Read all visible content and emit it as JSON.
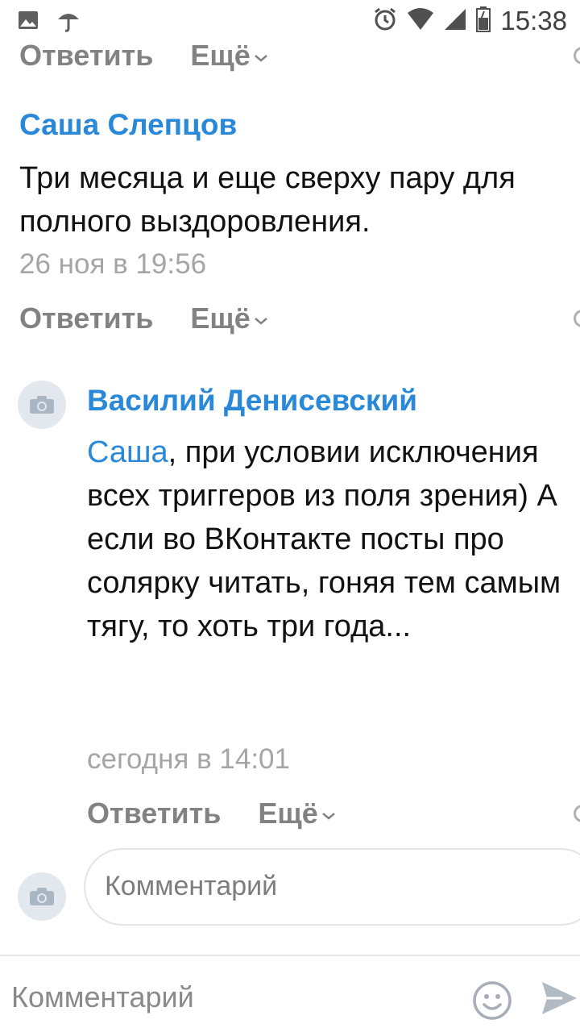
{
  "status_bar": {
    "time": "15:38",
    "icons": [
      "image-icon",
      "umbrella-icon",
      "alarm-icon",
      "wifi-icon",
      "signal-icon",
      "battery-icon"
    ]
  },
  "actions": {
    "reply_label": "Ответить",
    "more_label": "Ещё"
  },
  "comments": [
    {
      "author": "Саша Слепцов",
      "text": "Три месяца и еще сверху пару для полного выздоровления.",
      "time": "26 ноя в 19:56"
    },
    {
      "author": "Василий Денисевский",
      "mention": "Саша",
      "text": ", при условии исключения всех триггеров из поля зрения) А если во ВКонтакте посты про солярку читать, гоняя тем самым тягу, то хоть три года...",
      "time": "сегодня в 14:01"
    }
  ],
  "reply_box": {
    "placeholder": "Комментарий"
  },
  "bottom_bar": {
    "placeholder": "Комментарий"
  },
  "colors": {
    "link": "#2a88d9",
    "muted": "#828282",
    "timestamp": "#a5a5a5"
  }
}
